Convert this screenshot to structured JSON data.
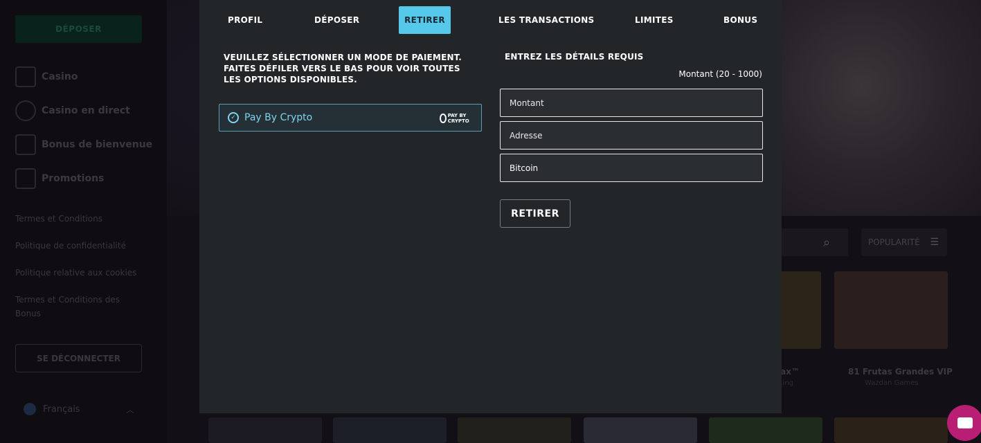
{
  "sidebar": {
    "deposit_label": "DÉPOSER",
    "nav": [
      {
        "label": "Casino",
        "icon": "slot-machine-icon"
      },
      {
        "label": "Casino en direct",
        "icon": "roulette-icon"
      },
      {
        "label": "Bonus de bienvenue",
        "icon": "gift-icon"
      },
      {
        "label": "Promotions",
        "icon": "promotions-icon"
      }
    ],
    "links": [
      "Termes et Conditions",
      "Politique de confidentialité",
      "Politique relative aux cookies",
      "Termes et Conditions des Bonus"
    ],
    "logout_label": "SE DÉCONNECTER",
    "language": "Français"
  },
  "background": {
    "filter_label": "POPULARITÉ",
    "games": [
      {
        "title": "81 Frutas Grandes VIP",
        "provider": "Wazdan Games"
      },
      {
        "title": "...max™",
        "provider": "...ing"
      }
    ]
  },
  "modal": {
    "tabs": [
      {
        "label": "PROFIL",
        "active": false
      },
      {
        "label": "DÉPOSER",
        "active": false
      },
      {
        "label": "RETIRER",
        "active": true
      },
      {
        "label": "LES TRANSACTIONS",
        "active": false
      },
      {
        "label": "LIMITES",
        "active": false
      },
      {
        "label": "BONUS",
        "active": false
      }
    ],
    "instructions": "VEUILLEZ SÉLECTIONNER UN MODE DE PAIEMENT. FAITES DÉFILER VERS LE BAS POUR VOIR TOUTES LES OPTIONS DISPONIBLES.",
    "method": {
      "label": "Pay By Crypto",
      "logo_text": "PAY BY CRYPTO"
    },
    "details_title": "ENTREZ LES DÉTAILS REQUIS",
    "amount_range": "Montant (20 - 1000)",
    "fields": [
      {
        "placeholder": "Montant",
        "value": ""
      },
      {
        "placeholder": "Adresse",
        "value": ""
      },
      {
        "placeholder": "",
        "value": "Bitcoin"
      }
    ],
    "submit_label": "RETIRER"
  },
  "colors": {
    "accent": "#56c9ea",
    "modal_bg": "#222628",
    "chat": "#b81e74"
  }
}
